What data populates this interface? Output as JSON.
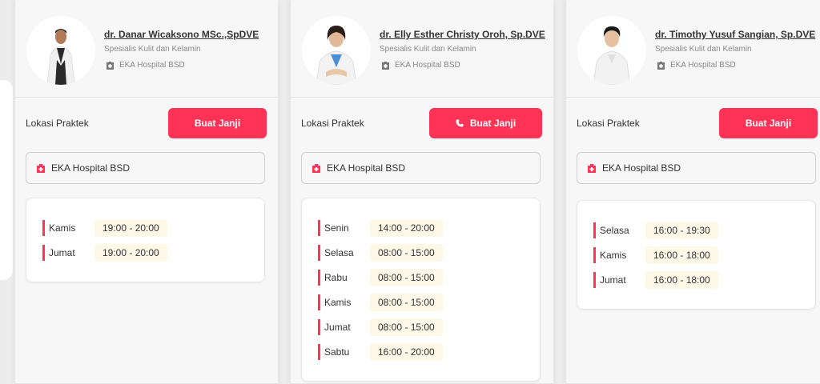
{
  "doctors": [
    {
      "name": "dr. Danar Wicaksono MSc.,SpDVE",
      "specialty": "Spesialis Kulit dan Kelamin",
      "hospital": "EKA Hospital BSD",
      "location_label": "Lokasi Praktek",
      "button_label": "Buat Janji",
      "location": "EKA Hospital BSD",
      "schedule": [
        {
          "day": "Kamis",
          "time": "19:00 - 20:00"
        },
        {
          "day": "Jumat",
          "time": "19:00 - 20:00"
        }
      ]
    },
    {
      "name": "dr. Elly Esther Christy Oroh, Sp.DVE",
      "specialty": "Spesialis Kulit dan Kelamin",
      "hospital": "EKA Hospital BSD",
      "location_label": "Lokasi Praktek",
      "button_label": "Buat Janji",
      "button_icon": "phone-icon",
      "location": "EKA Hospital BSD",
      "schedule": [
        {
          "day": "Senin",
          "time": "14:00 - 20:00"
        },
        {
          "day": "Selasa",
          "time": "08:00 - 15:00"
        },
        {
          "day": "Rabu",
          "time": "08:00 - 15:00"
        },
        {
          "day": "Kamis",
          "time": "08:00 - 15:00"
        },
        {
          "day": "Jumat",
          "time": "08:00 - 15:00"
        },
        {
          "day": "Sabtu",
          "time": "16:00 - 20:00"
        }
      ]
    },
    {
      "name": "dr. Timothy Yusuf Sangian, Sp.DVE",
      "specialty": "Spesialis Kulit dan Kelamin",
      "hospital": "EKA Hospital BSD",
      "location_label": "Lokasi Praktek",
      "button_label": "Buat Janji",
      "location": "EKA Hospital BSD",
      "schedule": [
        {
          "day": "Selasa",
          "time": "16:00 - 19:30"
        },
        {
          "day": "Kamis",
          "time": "16:00 - 18:00"
        },
        {
          "day": "Jumat",
          "time": "16:00 - 18:00"
        }
      ]
    }
  ],
  "colors": {
    "accent": "#ff3355",
    "time_bg": "#fdf8e8",
    "card_bg": "#f7f7f7"
  }
}
